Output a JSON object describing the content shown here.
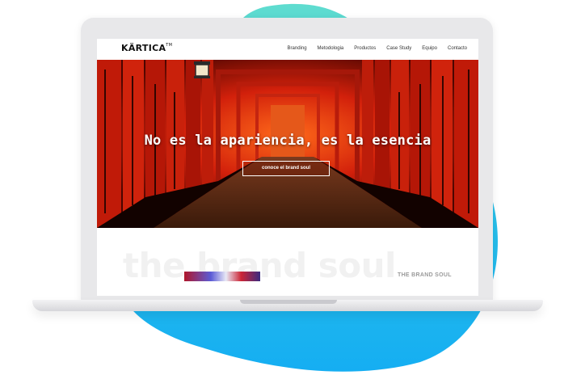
{
  "brand": {
    "logo_text": "KÄRTICA",
    "logo_mark": "TM"
  },
  "nav": {
    "items": [
      {
        "label": "Branding"
      },
      {
        "label": "Metodologia"
      },
      {
        "label": "Productos"
      },
      {
        "label": "Case Study"
      },
      {
        "label": "Equipo"
      },
      {
        "label": "Contacto"
      }
    ]
  },
  "hero": {
    "title": "No es la apariencia, es la esencia",
    "cta_label": "conoce el brand soul"
  },
  "section": {
    "background_heading": "the brand soul",
    "label": "THE BRAND SOUL"
  },
  "colors": {
    "blob_teal": "#59d9d6",
    "blob_blue": "#1fb6f0",
    "torii_red": "#d8200d",
    "laptop_frame": "#e8e8ea"
  }
}
